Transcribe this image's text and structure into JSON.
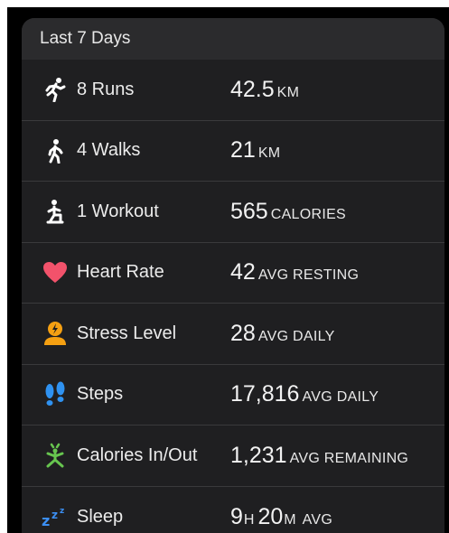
{
  "header": {
    "title": "Last 7 Days"
  },
  "colors": {
    "heart": "#f2526b",
    "stress": "#f5a012",
    "steps": "#2f92f1",
    "calories": "#67c54f",
    "sleep": "#3b8ef2"
  },
  "rows": [
    {
      "icon": "running-person-icon",
      "label": "8 Runs",
      "value": "42.5",
      "unit": "KM"
    },
    {
      "icon": "walking-person-icon",
      "label": "4 Walks",
      "value": "21",
      "unit": "KM"
    },
    {
      "icon": "workout-person-icon",
      "label": "1 Workout",
      "value": "565",
      "unit": "CALORIES"
    },
    {
      "icon": "heart-icon",
      "label": "Heart Rate",
      "value": "42",
      "unit": "AVG RESTING"
    },
    {
      "icon": "stress-icon",
      "label": "Stress Level",
      "value": "28",
      "unit": "AVG DAILY"
    },
    {
      "icon": "footprints-icon",
      "label": "Steps",
      "value": "17,816",
      "unit": "AVG DAILY"
    },
    {
      "icon": "calories-icon",
      "label": "Calories In/Out",
      "value": "1,231",
      "unit": "AVG REMAINING"
    },
    {
      "icon": "sleep-zzz-icon",
      "label": "Sleep",
      "hours": "9",
      "hours_unit": "H",
      "minutes": "20",
      "minutes_unit": "M",
      "unit": "AVG"
    }
  ]
}
